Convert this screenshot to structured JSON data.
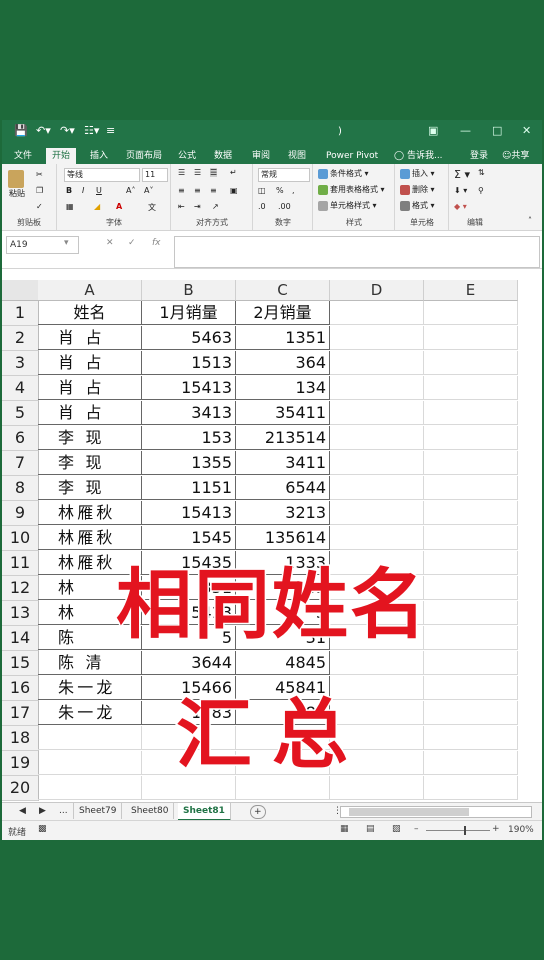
{
  "title_bar": {
    "title": ")"
  },
  "ribbon_tabs": [
    "文件",
    "开始",
    "插入",
    "页面布局",
    "公式",
    "数据",
    "审阅",
    "视图",
    "Power Pivot",
    "告诉我...",
    "登录",
    "共享"
  ],
  "ribbon": {
    "clipboard": {
      "label": "剪贴板",
      "paste": "粘贴"
    },
    "font": {
      "label": "字体",
      "font_name": "等线",
      "font_size": "11"
    },
    "alignment": {
      "label": "对齐方式"
    },
    "number": {
      "label": "数字",
      "format": "常规"
    },
    "styles": {
      "label": "样式",
      "conditional": "条件格式",
      "table": "套用表格格式",
      "cell_styles": "单元格样式"
    },
    "cells": {
      "label": "单元格",
      "insert": "插入",
      "delete": "删除",
      "format": "格式"
    },
    "editing": {
      "label": "编辑"
    }
  },
  "formula_bar": {
    "name_box": "A19",
    "fx": "fx",
    "value": ""
  },
  "columns": [
    "A",
    "B",
    "C",
    "D",
    "E"
  ],
  "rows": [
    {
      "n": "1",
      "a": "姓名",
      "b": "1月销量",
      "c": "2月销量"
    },
    {
      "n": "2",
      "a": "肖  占",
      "b": "5463",
      "c": "1351"
    },
    {
      "n": "3",
      "a": "肖  占",
      "b": "1513",
      "c": "364"
    },
    {
      "n": "4",
      "a": "肖  占",
      "b": "15413",
      "c": "134"
    },
    {
      "n": "5",
      "a": "肖  占",
      "b": "3413",
      "c": "35411"
    },
    {
      "n": "6",
      "a": "李  现",
      "b": "153",
      "c": "213514"
    },
    {
      "n": "7",
      "a": "李  现",
      "b": "1355",
      "c": "3411"
    },
    {
      "n": "8",
      "a": "李  现",
      "b": "1151",
      "c": "6544"
    },
    {
      "n": "9",
      "a": "林雁秋",
      "b": "15413",
      "c": "3213"
    },
    {
      "n": "10",
      "a": "林雁秋",
      "b": "1545",
      "c": "135614"
    },
    {
      "n": "11",
      "a": "林雁秋",
      "b": "15435",
      "c": "1333"
    },
    {
      "n": "12",
      "a": "林",
      "b": "351",
      "c": "545"
    },
    {
      "n": "13",
      "a": "林",
      "b": "5413",
      "c": "3"
    },
    {
      "n": "14",
      "a": "陈",
      "b": "5",
      "c": "31"
    },
    {
      "n": "15",
      "a": "陈  清",
      "b": "3644",
      "c": "4845"
    },
    {
      "n": "16",
      "a": "朱一龙",
      "b": "15466",
      "c": "45841"
    },
    {
      "n": "17",
      "a": "朱一龙",
      "b": "1583",
      "c": "784"
    },
    {
      "n": "18",
      "a": "",
      "b": "",
      "c": ""
    },
    {
      "n": "19",
      "a": "",
      "b": "",
      "c": ""
    },
    {
      "n": "20",
      "a": "",
      "b": "",
      "c": ""
    }
  ],
  "sheet_tabs": {
    "more": "...",
    "tabs": [
      "Sheet79",
      "Sheet80",
      "Sheet81"
    ],
    "active": "Sheet81",
    "add": "+"
  },
  "status": {
    "ready": "就绪",
    "zoom": "190%"
  },
  "overlay": {
    "line1": "相同姓名",
    "line2": "汇总"
  },
  "colors": {
    "overlay_text": "#e3141f",
    "excel_green": "#217346",
    "background": "#1d6a3a"
  }
}
